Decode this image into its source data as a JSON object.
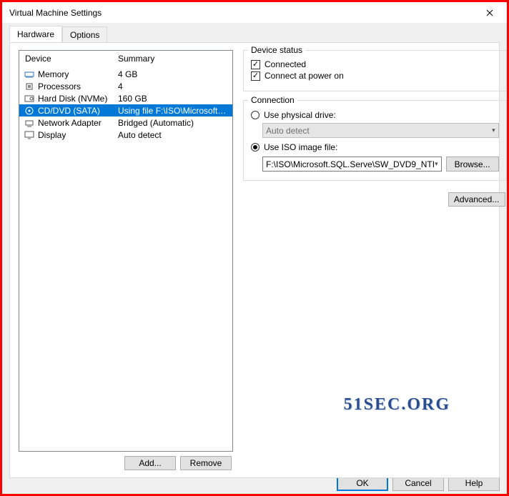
{
  "window": {
    "title": "Virtual Machine Settings"
  },
  "tabs": [
    {
      "label": "Hardware",
      "active": true
    },
    {
      "label": "Options",
      "active": false
    }
  ],
  "device_list": {
    "header_device": "Device",
    "header_summary": "Summary",
    "rows": [
      {
        "icon": "memory-icon",
        "name": "Memory",
        "summary": "4 GB",
        "selected": false
      },
      {
        "icon": "cpu-icon",
        "name": "Processors",
        "summary": "4",
        "selected": false
      },
      {
        "icon": "disk-icon",
        "name": "Hard Disk (NVMe)",
        "summary": "160 GB",
        "selected": false
      },
      {
        "icon": "cd-icon",
        "name": "CD/DVD (SATA)",
        "summary": "Using file F:\\ISO\\Microsoft.S...",
        "selected": true
      },
      {
        "icon": "network-icon",
        "name": "Network Adapter",
        "summary": "Bridged (Automatic)",
        "selected": false
      },
      {
        "icon": "display-icon",
        "name": "Display",
        "summary": "Auto detect",
        "selected": false
      }
    ]
  },
  "buttons": {
    "add": "Add...",
    "remove": "Remove",
    "ok": "OK",
    "cancel": "Cancel",
    "help": "Help",
    "browse": "Browse...",
    "advanced": "Advanced..."
  },
  "device_status": {
    "legend": "Device status",
    "connected_label": "Connected",
    "connected_checked": true,
    "power_on_label": "Connect at power on",
    "power_on_checked": true
  },
  "connection": {
    "legend": "Connection",
    "physical_label": "Use physical drive:",
    "physical_selected": false,
    "physical_value": "Auto detect",
    "iso_label": "Use ISO image file:",
    "iso_selected": true,
    "iso_value": "F:\\ISO\\Microsoft.SQL.Serve\\SW_DVD9_NTI"
  },
  "watermark": "51SEC.ORG"
}
